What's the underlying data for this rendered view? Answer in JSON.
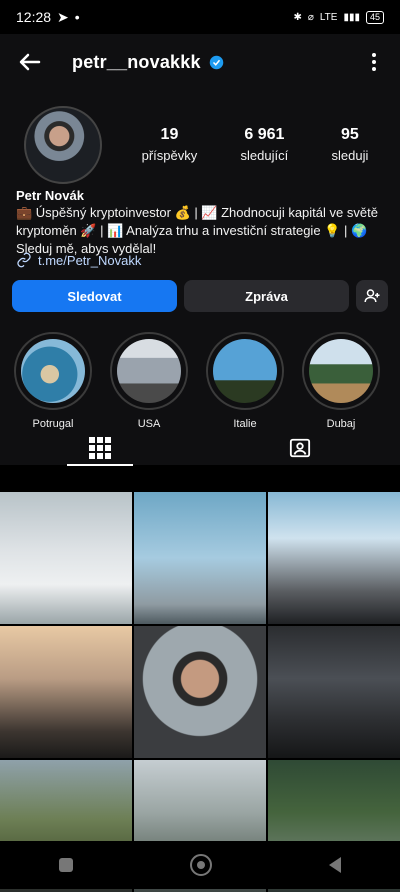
{
  "status": {
    "time": "12:28",
    "network": "LTE",
    "battery": "45"
  },
  "header": {
    "username": "petr__novakkk"
  },
  "profile": {
    "stats": [
      {
        "value": "19",
        "label": "příspěvky"
      },
      {
        "value": "6 961",
        "label": "sledující"
      },
      {
        "value": "95",
        "label": "sleduji"
      }
    ],
    "name": "Petr Novák",
    "bio": "💼 Úspěšný kryptoinvestor 💰 | 📈 Zhodnocuji kapitál ve světě kryptoměn 🚀 | 📊 Analýza trhu a investiční strategie 💡 | 🌍 Sleduj mě, abys vydělal!",
    "link": "t.me/Petr_Novakk"
  },
  "actions": {
    "follow_label": "Sledovat",
    "message_label": "Zpráva"
  },
  "highlights": [
    {
      "label": "Potrugal"
    },
    {
      "label": "USA"
    },
    {
      "label": "Italie"
    },
    {
      "label": "Dubaj"
    }
  ],
  "tabs": [
    {
      "icon": "grid-icon"
    },
    {
      "icon": "tagged-icon"
    }
  ],
  "grid_posts": 9
}
